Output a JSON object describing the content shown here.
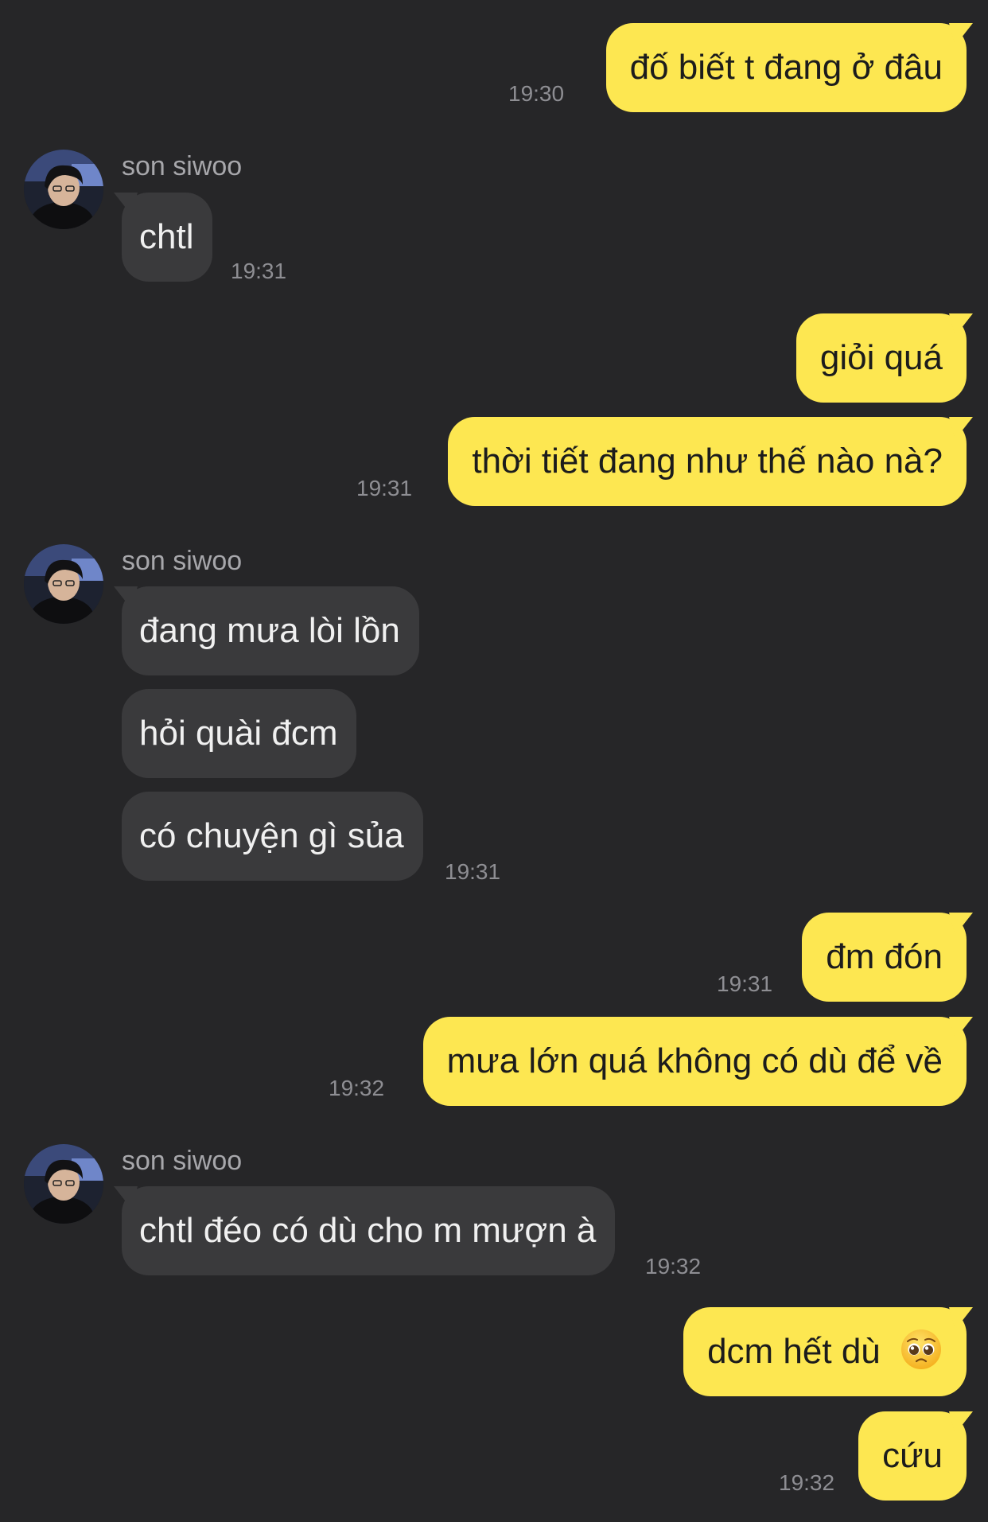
{
  "contact": {
    "name": "son siwoo"
  },
  "colors": {
    "background": "#262628",
    "outgoing_bubble": "#fde751",
    "incoming_bubble": "#3a3a3c",
    "timestamp": "#8e8e93"
  },
  "messages": [
    {
      "from": "me",
      "text": "đố biết t đang ở đâu",
      "time": "19:30"
    },
    {
      "from": "son siwoo",
      "text": "chtl",
      "time": "19:31"
    },
    {
      "from": "me",
      "text": "giỏi quá",
      "time": ""
    },
    {
      "from": "me",
      "text": "thời tiết đang như thế nào nà?",
      "time": "19:31"
    },
    {
      "from": "son siwoo",
      "text": "đang mưa lòi lồn",
      "time": ""
    },
    {
      "from": "son siwoo",
      "text": "hỏi quài đcm",
      "time": ""
    },
    {
      "from": "son siwoo",
      "text": "có chuyện gì sủa",
      "time": "19:31"
    },
    {
      "from": "me",
      "text": "đm đón",
      "time": "19:31"
    },
    {
      "from": "me",
      "text": "mưa lớn quá không có dù để về",
      "time": "19:32"
    },
    {
      "from": "son siwoo",
      "text": "chtl đéo có dù cho m mượn à",
      "time": "19:32"
    },
    {
      "from": "me",
      "text": "dcm hết dù",
      "time": "",
      "emoji": "pleading-face-icon"
    },
    {
      "from": "me",
      "text": "cứu",
      "time": "19:32"
    }
  ]
}
